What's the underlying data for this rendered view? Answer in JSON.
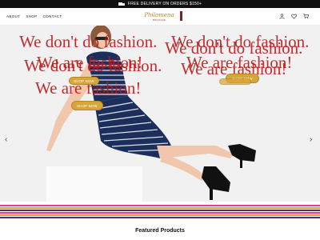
{
  "topbar": {
    "text": "FREE DELIVERY ON ORDERS $150+",
    "icon": "truck-icon"
  },
  "nav": {
    "about": "ABOUT",
    "shop": "SHOP",
    "contact": "CONTACT"
  },
  "logo": {
    "script": "Philomena",
    "tagline": "BOUTIQUE"
  },
  "header_icons": [
    "user-icon",
    "heart-icon",
    "cart-icon"
  ],
  "overlay_left": {
    "line1": "We don't do fashion.",
    "line2": "We are fashion!"
  },
  "overlay_right": {
    "line1": "We don't do fashion.",
    "line2": "We are fashion!"
  },
  "overlay_left_echo": {
    "line1": "We don't do fashion.",
    "line2": "We are fashion!"
  },
  "overlay_right_echo": {
    "line1": "We don't do fashion.",
    "line2": "We are fashion!"
  },
  "buttons": {
    "shop_now_left_small": "SHOP NOW",
    "shop_now_left_main": "SHOP NOW",
    "shop_now_right": "SHOP NOW"
  },
  "colors": {
    "overlay_text": "#c01818",
    "button": "#d8a53a",
    "stripe_pink": "#e8379b",
    "stripe_gold": "#d9a33a",
    "stripe_purple": "#5b2b7a"
  },
  "featured_heading": "Featured Products"
}
